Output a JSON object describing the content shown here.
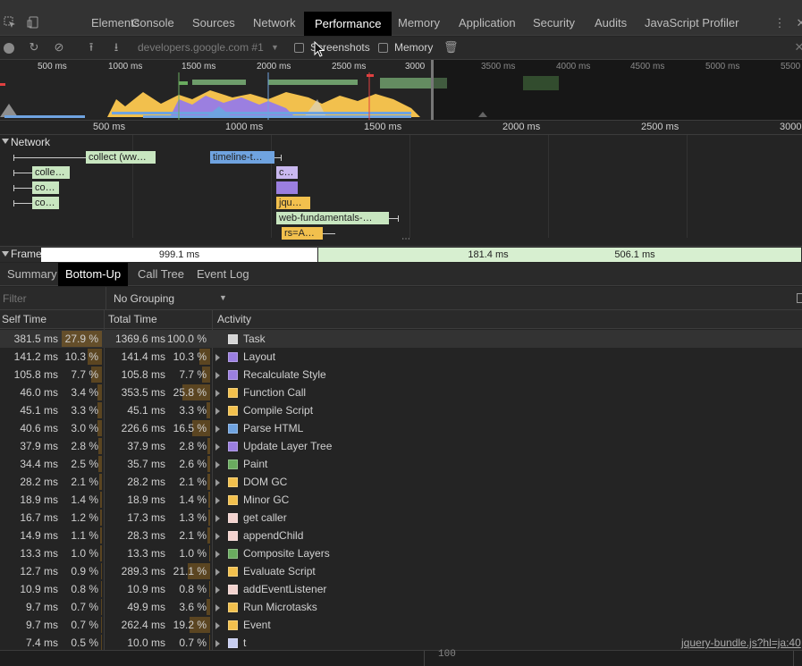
{
  "tabs": [
    {
      "label": "Elements"
    },
    {
      "label": "Console"
    },
    {
      "label": "Sources"
    },
    {
      "label": "Network"
    },
    {
      "label": "Performance",
      "active": true
    },
    {
      "label": "Memory"
    },
    {
      "label": "Application"
    },
    {
      "label": "Security"
    },
    {
      "label": "Audits"
    },
    {
      "label": "JavaScript Profiler"
    }
  ],
  "toolbar": {
    "profile_select": "developers.google.com #1",
    "screenshots_label": "Screenshots",
    "memory_label": "Memory"
  },
  "overview": {
    "ticks": [
      "500 ms",
      "1000 ms",
      "1500 ms",
      "2000 ms",
      "2500 ms",
      "3000",
      "3500 ms",
      "4000 ms",
      "4500 ms",
      "5000 ms",
      "5500"
    ]
  },
  "ruler": {
    "ticks": [
      "500 ms",
      "1000 ms",
      "1500 ms",
      "2000 ms",
      "2500 ms",
      "3000"
    ]
  },
  "network": {
    "title": "Network",
    "requests": [
      {
        "label": "collect (ww…",
        "color": "#c8e6c0"
      },
      {
        "label": "timeline-t…",
        "color": "#6fa3e0"
      },
      {
        "label": "colle…",
        "color": "#c8e6c0"
      },
      {
        "label": "c…",
        "color": "#c9b8ef"
      },
      {
        "label": "co…",
        "color": "#c8e6c0"
      },
      {
        "label": "co…",
        "color": "#c8e6c0"
      },
      {
        "label": "jqu…",
        "color": "#f2c04d"
      },
      {
        "label": "web-fundamentals-…",
        "color": "#c8e6c0"
      },
      {
        "label": "rs=A…",
        "color": "#f2c04d"
      }
    ]
  },
  "frames": {
    "title": "Frames",
    "items": [
      "999.1 ms",
      "181.4 ms",
      "506.1 ms"
    ]
  },
  "subtabs": [
    {
      "label": "Summary"
    },
    {
      "label": "Bottom-Up",
      "active": true
    },
    {
      "label": "Call Tree"
    },
    {
      "label": "Event Log"
    }
  ],
  "filter": {
    "placeholder": "Filter",
    "grouping": "No Grouping"
  },
  "table": {
    "headers": {
      "self": "Self Time",
      "total": "Total Time",
      "activity": "Activity"
    },
    "rows": [
      {
        "self": "381.5 ms",
        "self_pct": "27.9 %",
        "total": "1369.6 ms",
        "total_pct": "100.0 %",
        "activity": "Task",
        "color": "#d6d6d6",
        "self_frac": 0.279,
        "total_frac": 1.0,
        "expandable": false
      },
      {
        "self": "141.2 ms",
        "self_pct": "10.3 %",
        "total": "141.4 ms",
        "total_pct": "10.3 %",
        "activity": "Layout",
        "color": "#9b7fe0",
        "self_frac": 0.103,
        "total_frac": 0.103,
        "expandable": true
      },
      {
        "self": "105.8 ms",
        "self_pct": "7.7 %",
        "total": "105.8 ms",
        "total_pct": "7.7 %",
        "activity": "Recalculate Style",
        "color": "#9b7fe0",
        "self_frac": 0.077,
        "total_frac": 0.077,
        "expandable": true
      },
      {
        "self": "46.0 ms",
        "self_pct": "3.4 %",
        "total": "353.5 ms",
        "total_pct": "25.8 %",
        "activity": "Function Call",
        "color": "#f2c04d",
        "self_frac": 0.034,
        "total_frac": 0.258,
        "expandable": true
      },
      {
        "self": "45.1 ms",
        "self_pct": "3.3 %",
        "total": "45.1 ms",
        "total_pct": "3.3 %",
        "activity": "Compile Script",
        "color": "#f2c04d",
        "self_frac": 0.033,
        "total_frac": 0.033,
        "expandable": true
      },
      {
        "self": "40.6 ms",
        "self_pct": "3.0 %",
        "total": "226.6 ms",
        "total_pct": "16.5 %",
        "activity": "Parse HTML",
        "color": "#6fa3e0",
        "self_frac": 0.03,
        "total_frac": 0.165,
        "expandable": true
      },
      {
        "self": "37.9 ms",
        "self_pct": "2.8 %",
        "total": "37.9 ms",
        "total_pct": "2.8 %",
        "activity": "Update Layer Tree",
        "color": "#9b7fe0",
        "self_frac": 0.028,
        "total_frac": 0.028,
        "expandable": true
      },
      {
        "self": "34.4 ms",
        "self_pct": "2.5 %",
        "total": "35.7 ms",
        "total_pct": "2.6 %",
        "activity": "Paint",
        "color": "#6aab5f",
        "self_frac": 0.025,
        "total_frac": 0.026,
        "expandable": true
      },
      {
        "self": "28.2 ms",
        "self_pct": "2.1 %",
        "total": "28.2 ms",
        "total_pct": "2.1 %",
        "activity": "DOM GC",
        "color": "#f2c04d",
        "self_frac": 0.021,
        "total_frac": 0.021,
        "expandable": true
      },
      {
        "self": "18.9 ms",
        "self_pct": "1.4 %",
        "total": "18.9 ms",
        "total_pct": "1.4 %",
        "activity": "Minor GC",
        "color": "#f2c04d",
        "self_frac": 0.014,
        "total_frac": 0.014,
        "expandable": true
      },
      {
        "self": "16.7 ms",
        "self_pct": "1.2 %",
        "total": "17.3 ms",
        "total_pct": "1.3 %",
        "activity": "get caller",
        "color": "#f3d3cf",
        "self_frac": 0.012,
        "total_frac": 0.013,
        "expandable": true
      },
      {
        "self": "14.9 ms",
        "self_pct": "1.1 %",
        "total": "28.3 ms",
        "total_pct": "2.1 %",
        "activity": "appendChild",
        "color": "#f3d3cf",
        "self_frac": 0.011,
        "total_frac": 0.021,
        "expandable": true
      },
      {
        "self": "13.3 ms",
        "self_pct": "1.0 %",
        "total": "13.3 ms",
        "total_pct": "1.0 %",
        "activity": "Composite Layers",
        "color": "#6aab5f",
        "self_frac": 0.01,
        "total_frac": 0.01,
        "expandable": true
      },
      {
        "self": "12.7 ms",
        "self_pct": "0.9 %",
        "total": "289.3 ms",
        "total_pct": "21.1 %",
        "activity": "Evaluate Script",
        "color": "#f2c04d",
        "self_frac": 0.009,
        "total_frac": 0.211,
        "expandable": true
      },
      {
        "self": "10.9 ms",
        "self_pct": "0.8 %",
        "total": "10.9 ms",
        "total_pct": "0.8 %",
        "activity": "addEventListener",
        "color": "#f3d3cf",
        "self_frac": 0.008,
        "total_frac": 0.008,
        "expandable": true
      },
      {
        "self": "9.7 ms",
        "self_pct": "0.7 %",
        "total": "49.9 ms",
        "total_pct": "3.6 %",
        "activity": "Run Microtasks",
        "color": "#f2c04d",
        "self_frac": 0.007,
        "total_frac": 0.036,
        "expandable": true
      },
      {
        "self": "9.7 ms",
        "self_pct": "0.7 %",
        "total": "262.4 ms",
        "total_pct": "19.2 %",
        "activity": "Event",
        "color": "#f2c04d",
        "self_frac": 0.007,
        "total_frac": 0.192,
        "expandable": true
      },
      {
        "self": "7.4 ms",
        "self_pct": "0.5 %",
        "total": "10.0 ms",
        "total_pct": "0.7 %",
        "activity": "t",
        "color": "#c7cdf0",
        "self_frac": 0.005,
        "total_frac": 0.007,
        "expandable": true
      }
    ],
    "source_link": "jquery-bundle.js?hl=ja:40"
  },
  "bottom": {
    "line_number": "100"
  }
}
